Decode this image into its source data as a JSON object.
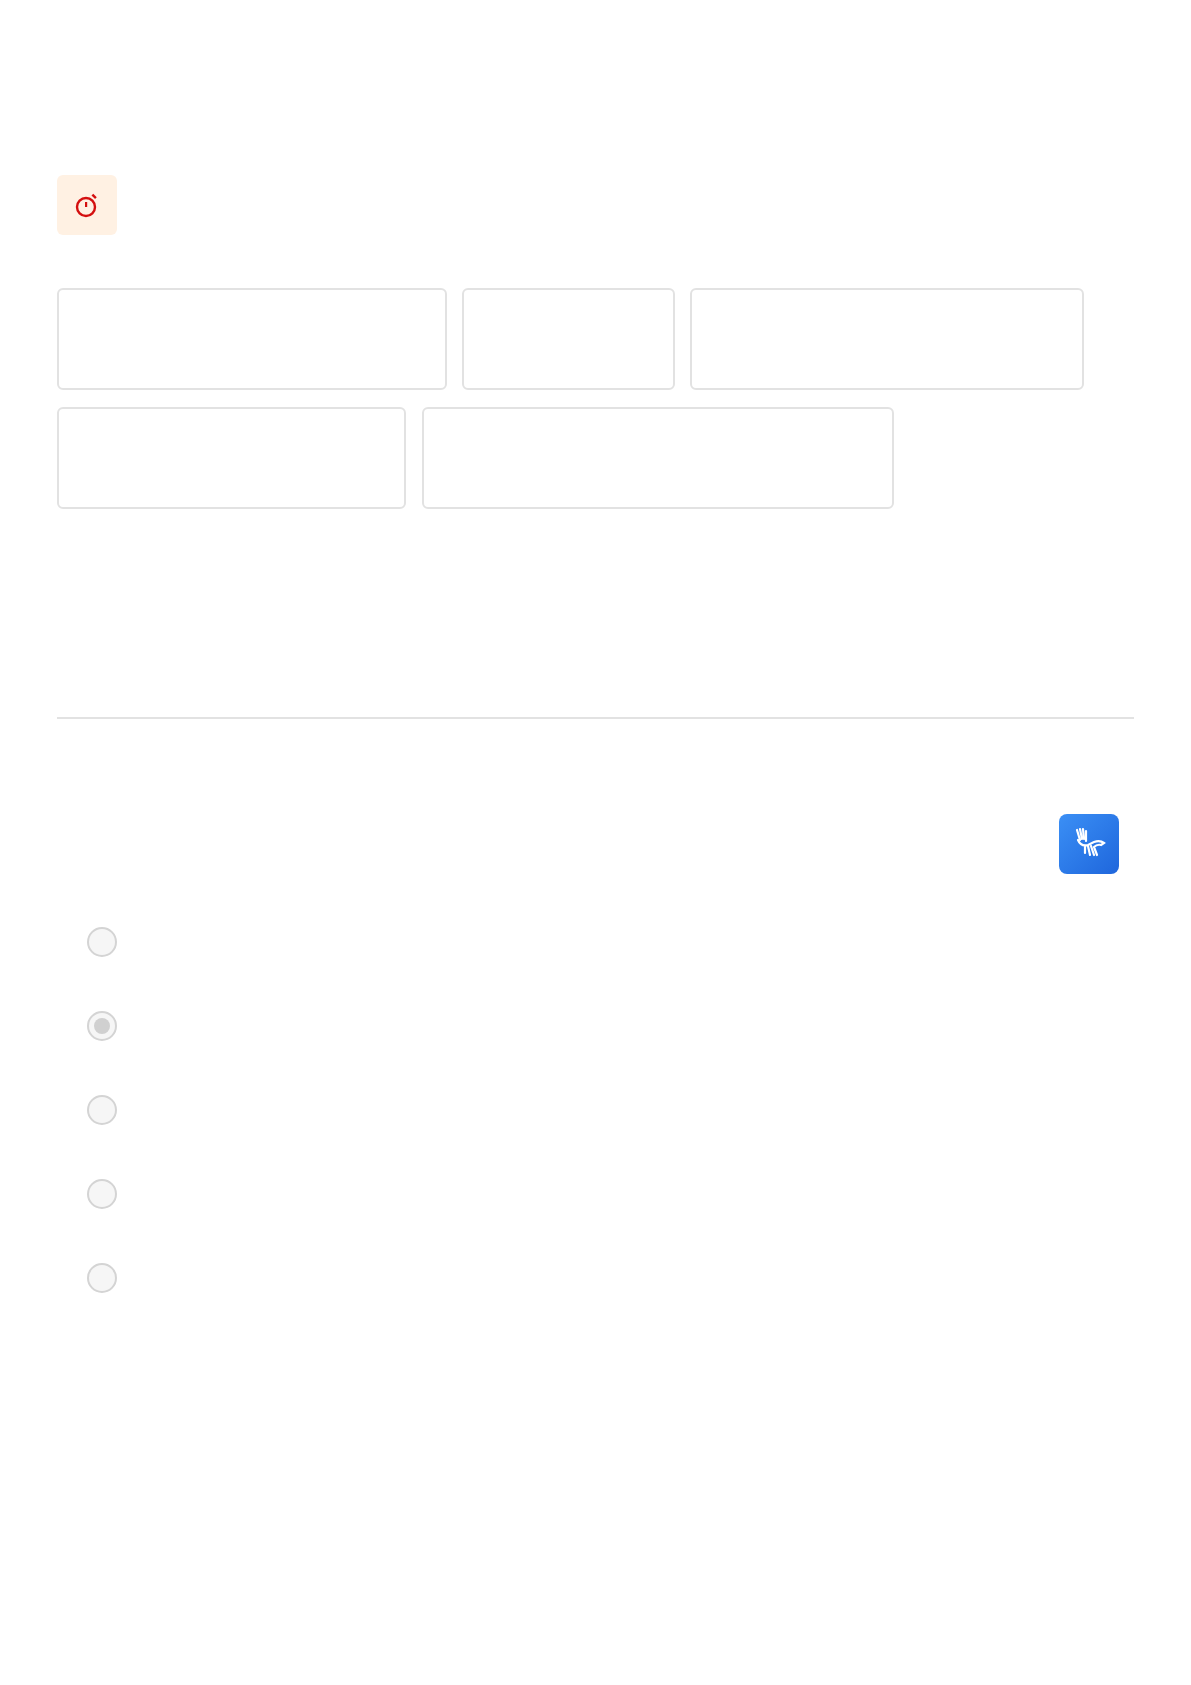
{
  "options": [
    {
      "selected": false
    },
    {
      "selected": true
    },
    {
      "selected": false
    },
    {
      "selected": false
    },
    {
      "selected": false
    }
  ]
}
